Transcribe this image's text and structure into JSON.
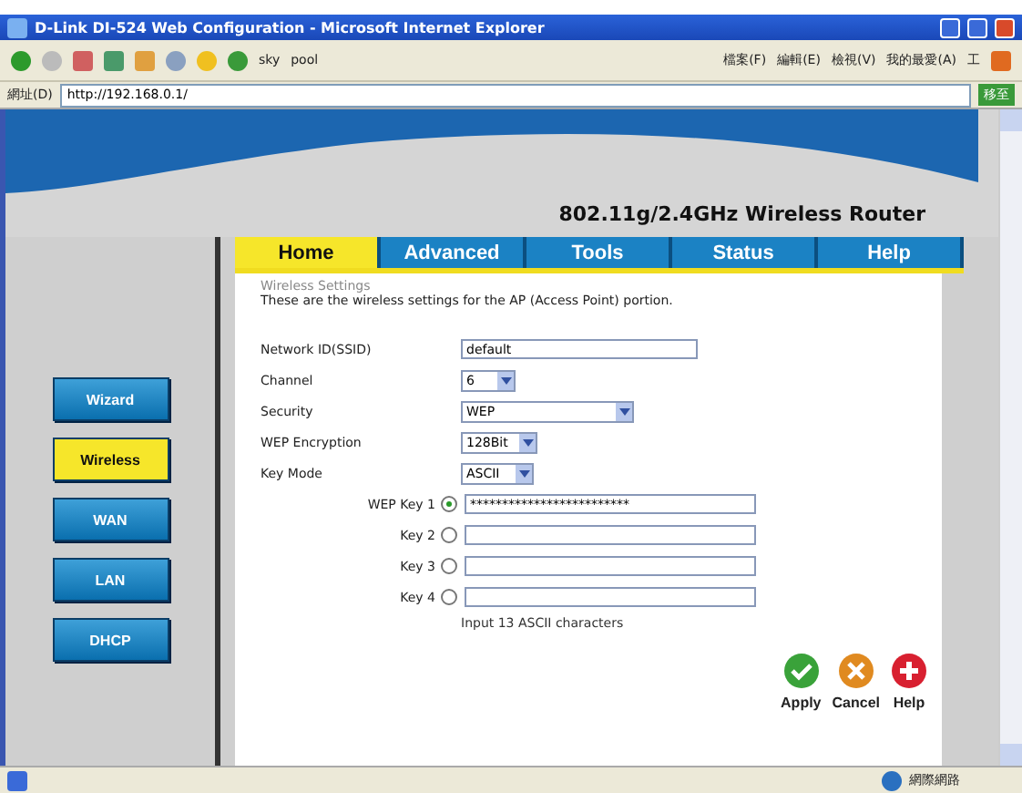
{
  "window": {
    "title": "D-Link DI-524 Web Configuration - Microsoft Internet Explorer"
  },
  "toolbar": {
    "links": [
      "sky",
      "pool"
    ],
    "menu": [
      "檔案(F)",
      "編輯(E)",
      "檢視(V)",
      "我的最愛(A)",
      "工"
    ]
  },
  "address_bar": {
    "label": "網址(D)",
    "url": "http://192.168.0.1/",
    "go": "移至"
  },
  "page": {
    "product": "802.11g/2.4GHz Wireless Router",
    "tabs": [
      {
        "label": "Home",
        "selected": true
      },
      {
        "label": "Advanced",
        "selected": false
      },
      {
        "label": "Tools",
        "selected": false
      },
      {
        "label": "Status",
        "selected": false
      },
      {
        "label": "Help",
        "selected": false
      }
    ],
    "sidebar": [
      {
        "label": "Wizard",
        "selected": false
      },
      {
        "label": "Wireless",
        "selected": true
      },
      {
        "label": "WAN",
        "selected": false
      },
      {
        "label": "LAN",
        "selected": false
      },
      {
        "label": "DHCP",
        "selected": false
      }
    ],
    "section_title": "Wireless Settings",
    "description": "These are the wireless settings for the AP (Access Point) portion.",
    "fields": [
      {
        "kind": "text",
        "label": "Network ID(SSID)",
        "value": "default"
      },
      {
        "kind": "select",
        "label": "Channel",
        "value": "6"
      },
      {
        "kind": "select",
        "label": "Security",
        "value": "WEP"
      },
      {
        "kind": "select",
        "label": "WEP Encryption",
        "value": "128Bit"
      },
      {
        "kind": "select",
        "label": "Key Mode",
        "value": "ASCII"
      }
    ],
    "keys": [
      {
        "label": "WEP Key 1",
        "selected": true,
        "value": "*************************"
      },
      {
        "label": "Key 2",
        "selected": false
      },
      {
        "label": "Key 3",
        "selected": false
      },
      {
        "label": "Key 4",
        "selected": false
      }
    ],
    "hint": "Input 13 ASCII characters",
    "actions": [
      {
        "kind": "apply",
        "label": "Apply"
      },
      {
        "kind": "cancel",
        "label": "Cancel"
      },
      {
        "kind": "help",
        "label": "Help"
      }
    ]
  },
  "status_bar": {
    "zone": "網際網路"
  }
}
